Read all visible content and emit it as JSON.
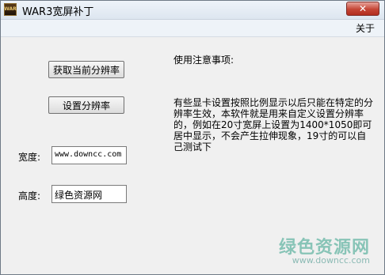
{
  "window": {
    "title": "WAR3宽屏补丁",
    "icon_text": "WAR",
    "close_symbol": "✕"
  },
  "menu": {
    "about": "关于"
  },
  "buttons": {
    "get_resolution": "获取当前分辨率",
    "set_resolution": "设置分辨率"
  },
  "fields": {
    "width_label": "宽度:",
    "width_value": "www.downcc.com",
    "height_label": "高度:",
    "height_value": "绿色资源网"
  },
  "notes": {
    "title": "使用注意事项:",
    "body": "有些显卡设置按照比例显示以后只能在特定的分辨率生效，本软件就是用来自定义设置分辨率的，例如在20寸宽屏上设置为1400*1050即可居中显示，不会产生拉伸现象，19寸的可以自己测试下"
  },
  "watermark": {
    "main": "绿色资源网",
    "sub": "www.downcc.com"
  }
}
